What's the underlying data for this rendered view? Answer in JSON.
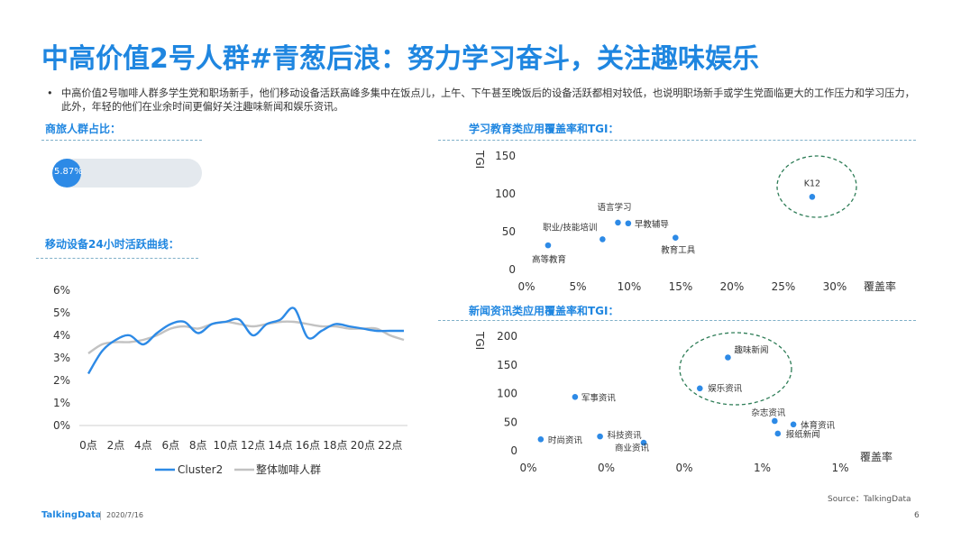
{
  "title": "中高价值2号人群#青葱后浪：努力学习奋斗，关注趣味娱乐",
  "bullet": {
    "dot": "•",
    "text": "中高价值2号咖啡人群多学生党和职场新手，他们移动设备活跃高峰多集中在饭点儿，上午、下午甚至晚饭后的设备活跃都相对较低，也说明职场新手或学生党面临更大的工作压力和学习压力，此外，年轻的他们在业余时间更偏好关注趣味新闻和娱乐资讯。"
  },
  "sections": {
    "business": "商旅人群占比：",
    "activity": "移动设备24小时活跃曲线：",
    "education": "学习教育类应用覆盖率和TGI：",
    "news": "新闻资讯类应用覆盖率和TGI："
  },
  "progress": {
    "value": 0.0587,
    "label": "5.87%",
    "color": "#2d8ae6"
  },
  "colors": {
    "accent": "#1f86e0",
    "series1": "#2d8ae6",
    "series2": "#c2c2c2",
    "circle": "#2e7d57"
  },
  "chart_data": [
    {
      "type": "line",
      "x": [
        "0点",
        "1点",
        "2点",
        "3点",
        "4点",
        "5点",
        "6点",
        "7点",
        "8点",
        "9点",
        "10点",
        "11点",
        "12点",
        "13点",
        "14点",
        "15点",
        "16点",
        "17点",
        "18点",
        "19点",
        "20点",
        "21点",
        "22点",
        "23点"
      ],
      "xticks": [
        "0点",
        "2点",
        "4点",
        "6点",
        "8点",
        "10点",
        "12点",
        "14点",
        "16点",
        "18点",
        "20点",
        "22点"
      ],
      "yticks": [
        "0%",
        "1%",
        "2%",
        "3%",
        "4%",
        "5%",
        "6%"
      ],
      "ylim": [
        0,
        6
      ],
      "series": [
        {
          "name": "Cluster2",
          "values": [
            2.3,
            3.3,
            3.8,
            4.0,
            3.6,
            4.1,
            4.5,
            4.6,
            4.1,
            4.5,
            4.6,
            4.7,
            4.0,
            4.5,
            4.7,
            5.2,
            3.9,
            4.2,
            4.5,
            4.4,
            4.3,
            4.2,
            4.2,
            4.2
          ]
        },
        {
          "name": "整体咖啡人群",
          "values": [
            3.2,
            3.6,
            3.7,
            3.7,
            3.8,
            4.0,
            4.3,
            4.4,
            4.3,
            4.5,
            4.6,
            4.5,
            4.4,
            4.5,
            4.6,
            4.6,
            4.5,
            4.4,
            4.4,
            4.3,
            4.3,
            4.3,
            4.0,
            3.8
          ]
        }
      ],
      "legend": "bottom"
    },
    {
      "type": "scatter",
      "xlabel": "覆盖率",
      "ylabel": "TGI",
      "xlim": [
        0,
        30
      ],
      "ylim": [
        0,
        150
      ],
      "xticks": [
        "0%",
        "5%",
        "10%",
        "15%",
        "20%",
        "25%",
        "30%"
      ],
      "yticks": [
        "0",
        "50",
        "100",
        "150"
      ],
      "points": [
        {
          "label": "K12",
          "x": 27.8,
          "y": 96
        },
        {
          "label": "语言学习",
          "x": 8.9,
          "y": 62
        },
        {
          "label": "早教辅导",
          "x": 9.9,
          "y": 61
        },
        {
          "label": "职业/技能培训",
          "x": 7.4,
          "y": 40
        },
        {
          "label": "教育工具",
          "x": 14.5,
          "y": 42
        },
        {
          "label": "高等教育",
          "x": 2.1,
          "y": 32
        }
      ]
    },
    {
      "type": "scatter",
      "xlabel": "覆盖率",
      "ylabel": "TGI",
      "xlim": [
        0,
        1
      ],
      "ylim": [
        0,
        200
      ],
      "xticks": [
        "0%",
        "0%",
        "0%",
        "1%",
        "1%"
      ],
      "yticks": [
        "0",
        "50",
        "100",
        "150",
        "200"
      ],
      "points": [
        {
          "label": "趣味新闻",
          "x": 0.64,
          "y": 163
        },
        {
          "label": "娱乐资讯",
          "x": 0.55,
          "y": 109
        },
        {
          "label": "军事资讯",
          "x": 0.15,
          "y": 94
        },
        {
          "label": "杂志资讯",
          "x": 0.79,
          "y": 52
        },
        {
          "label": "体育资讯",
          "x": 0.85,
          "y": 46
        },
        {
          "label": "报纸新闻",
          "x": 0.8,
          "y": 30
        },
        {
          "label": "时尚资讯",
          "x": 0.04,
          "y": 20
        },
        {
          "label": "科技资讯",
          "x": 0.23,
          "y": 25
        },
        {
          "label": "商业资讯",
          "x": 0.37,
          "y": 14
        }
      ]
    }
  ],
  "footer": {
    "logo": "TalkingData",
    "date": "2020/7/16",
    "source": "Source：TalkingData",
    "page": "6"
  }
}
